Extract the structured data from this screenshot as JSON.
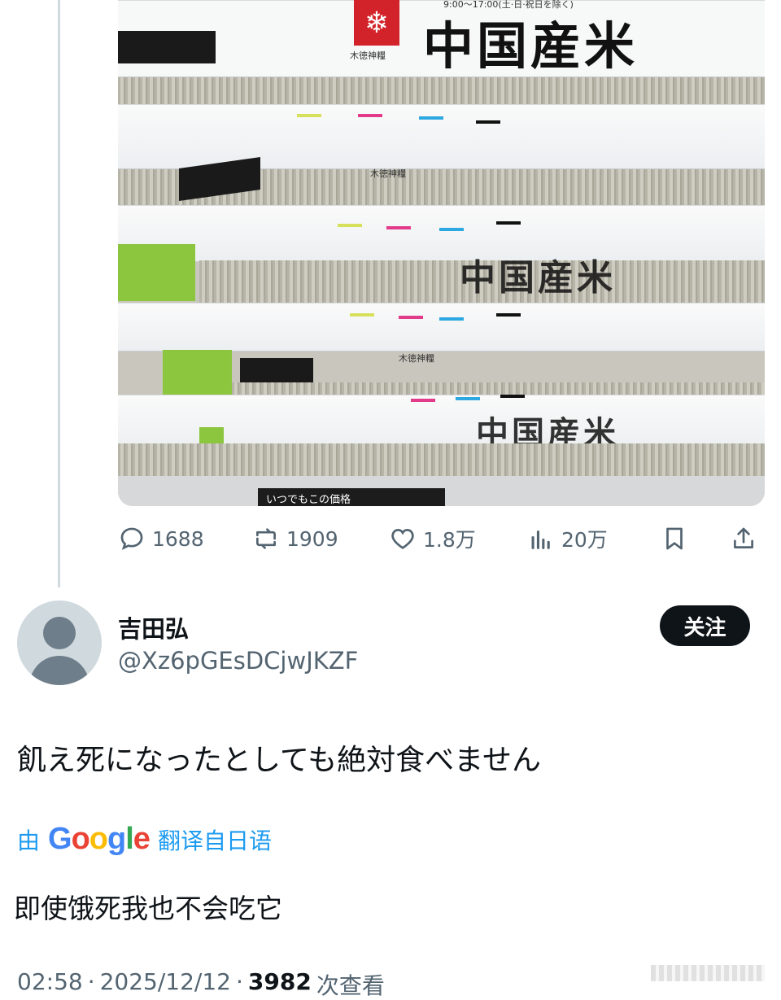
{
  "photo": {
    "header_text": "9:00～17:00(土·日·祝日を除く)",
    "brand_small": "木徳神糧",
    "bag_label": "中国産米",
    "price_sign": "いつでもこの価格"
  },
  "actions": {
    "replies": "1688",
    "retweets": "1909",
    "likes": "1.8万",
    "views": "20万"
  },
  "reply": {
    "display_name": "吉田弘",
    "handle": "@Xz6pGEsDCjwJKZF",
    "follow_label": "关注",
    "text": "飢え死になったとしても絶対食べません",
    "translate_prefix": "由",
    "google_letters": [
      "G",
      "o",
      "o",
      "g",
      "l",
      "e"
    ],
    "translate_suffix": "翻译自日语",
    "translation": "即使饿死我也不会吃它",
    "time": "02:58",
    "date": "2025/12/12",
    "view_count": "3982",
    "view_suffix": "次查看"
  },
  "colors": {
    "accent": "#1d9bf0",
    "muted": "#536471",
    "text": "#0f1419",
    "brand_red": "#d3232a"
  }
}
